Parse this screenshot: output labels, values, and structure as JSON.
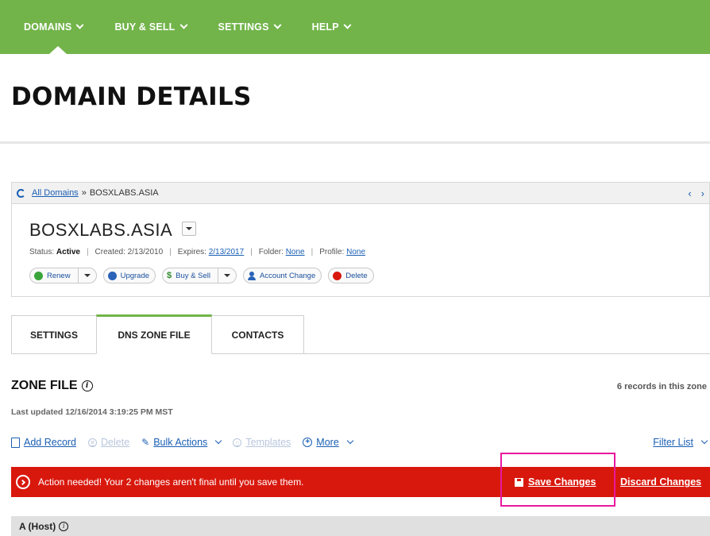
{
  "nav": {
    "items": [
      {
        "label": "DOMAINS"
      },
      {
        "label": "BUY & SELL"
      },
      {
        "label": "SETTINGS"
      },
      {
        "label": "HELP"
      }
    ]
  },
  "page": {
    "title": "DOMAIN DETAILS"
  },
  "breadcrumb": {
    "root": "All Domains",
    "separator": "»",
    "current": "BOSXLABS.ASIA"
  },
  "domain": {
    "name": "BOSXLABS.ASIA",
    "status_label": "Status:",
    "status_value": "Active",
    "created_label": "Created: 2/13/2010",
    "expires_label": "Expires:",
    "expires_value": "2/13/2017",
    "folder_label": "Folder:",
    "folder_value": "None",
    "profile_label": "Profile:",
    "profile_value": "None"
  },
  "actions": {
    "renew": "Renew",
    "upgrade": "Upgrade",
    "buy_sell": "Buy & Sell",
    "account_change": "Account Change",
    "delete": "Delete"
  },
  "tabs": [
    {
      "label": "SETTINGS"
    },
    {
      "label": "DNS ZONE FILE",
      "active": true
    },
    {
      "label": "CONTACTS"
    }
  ],
  "zone": {
    "title": "ZONE FILE",
    "records_count": "6 records in this zone",
    "last_updated": "Last updated 12/16/2014 3:19:25 PM MST"
  },
  "toolbar": {
    "add_record": "Add Record",
    "delete": "Delete",
    "bulk_actions": "Bulk Actions",
    "templates": "Templates",
    "more": "More",
    "filter_list": "Filter List"
  },
  "alert": {
    "message": "Action needed! Your 2 changes aren't final until you save them.",
    "save": "Save Changes",
    "discard": "Discard Changes"
  },
  "section": {
    "title": "A (Host)"
  },
  "colors": {
    "nav_green": "#72b44a",
    "alert_red": "#d9180d",
    "link_blue": "#1a5fb4",
    "highlight_pink": "#e8199e"
  }
}
